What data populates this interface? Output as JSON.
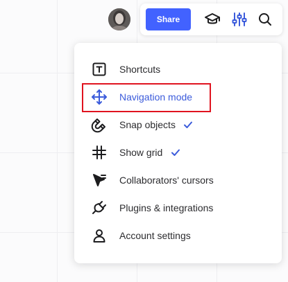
{
  "topbar": {
    "share_label": "Share",
    "icons": [
      "graduation-cap-icon",
      "sliders-icon",
      "search-icon"
    ]
  },
  "menu": {
    "items": [
      {
        "label": "Shortcuts",
        "icon": "keyboard-t-icon",
        "checked": false
      },
      {
        "label": "Navigation mode",
        "icon": "move-arrows-icon",
        "checked": false,
        "active": true
      },
      {
        "label": "Snap objects",
        "icon": "magnet-icon",
        "checked": true
      },
      {
        "label": "Show grid",
        "icon": "grid-icon",
        "checked": true
      },
      {
        "label": "Collaborators' cursors",
        "icon": "cursor-icon",
        "checked": false
      },
      {
        "label": "Plugins & integrations",
        "icon": "plug-icon",
        "checked": false
      },
      {
        "label": "Account settings",
        "icon": "user-icon",
        "checked": false
      }
    ]
  },
  "colors": {
    "accent": "#4262ff",
    "active_text": "#3b5bdb",
    "highlight": "#e0131f",
    "check": "#3b5bdb"
  }
}
